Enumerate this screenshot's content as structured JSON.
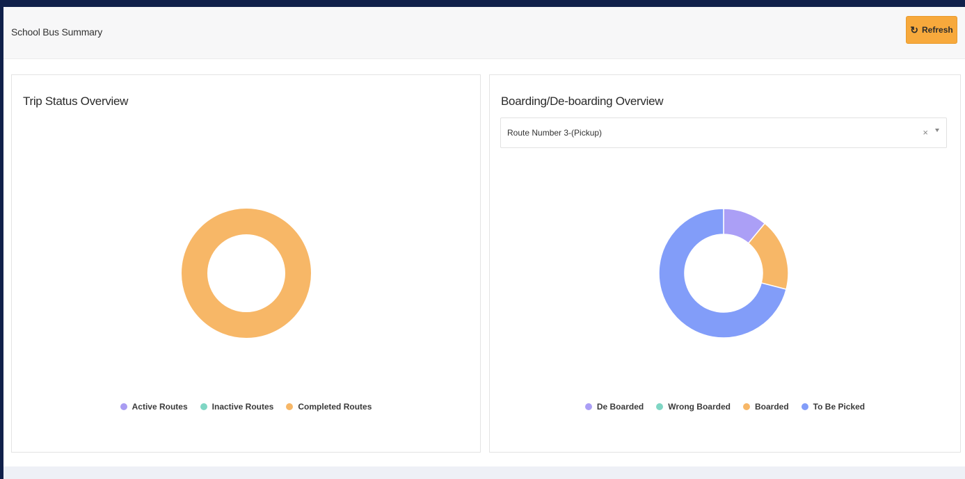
{
  "header": {
    "title": "School Bus Summary",
    "refresh_label": "Refresh",
    "refresh_icon": "refresh-icon"
  },
  "trip_status": {
    "title": "Trip Status Overview",
    "chart_data": {
      "type": "pie",
      "donut": true,
      "categories": [
        "Active Routes",
        "Inactive Routes",
        "Completed Routes"
      ],
      "values": [
        0,
        0,
        1
      ],
      "colors": [
        "#a99cf2",
        "#7fd6c4",
        "#f7b767"
      ],
      "legend_placement": "bottom"
    }
  },
  "boarding": {
    "title": "Boarding/De-boarding Overview",
    "route_select": {
      "value": "Route Number 3-(Pickup)",
      "clear_label": "×"
    },
    "chart_data": {
      "type": "pie",
      "donut": true,
      "categories": [
        "De Boarded",
        "Wrong Boarded",
        "Boarded",
        "To Be Picked"
      ],
      "values": [
        11,
        0,
        18,
        71
      ],
      "colors": [
        "#ab9ff6",
        "#7fd6c4",
        "#f7b767",
        "#829df9"
      ],
      "legend_placement": "bottom"
    }
  }
}
